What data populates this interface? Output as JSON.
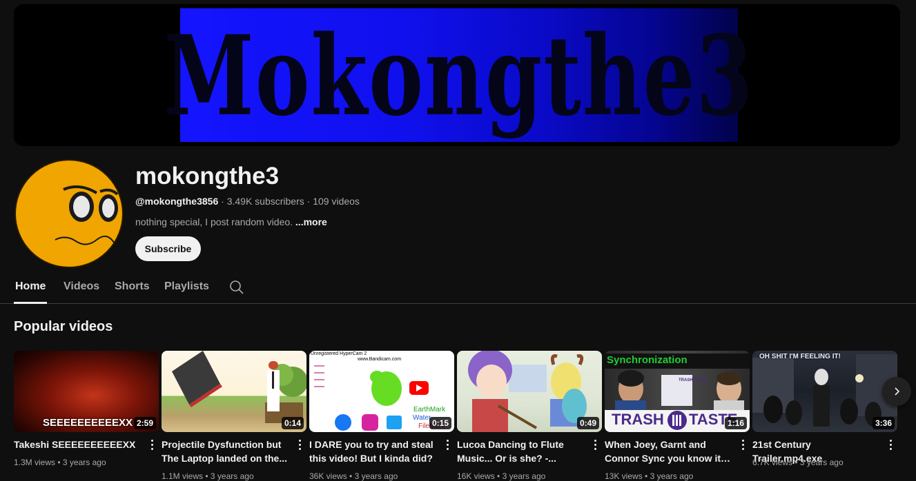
{
  "banner": {
    "text": "Mokongthe3"
  },
  "channel": {
    "name": "mokongthe3",
    "handle": "@mokongthe3856",
    "subscribers": "3.49K subscribers",
    "videos_count": "109 videos",
    "description": "nothing special, I post random video.",
    "more_label": "...more",
    "subscribe_label": "Subscribe"
  },
  "tabs": [
    {
      "label": "Home",
      "active": true
    },
    {
      "label": "Videos",
      "active": false
    },
    {
      "label": "Shorts",
      "active": false
    },
    {
      "label": "Playlists",
      "active": false
    }
  ],
  "section": {
    "title": "Popular videos"
  },
  "videos": [
    {
      "title": "Takeshi SEEEEEEEEEEXX",
      "duration": "2:59",
      "views": "1.3M views",
      "age": "3 years ago",
      "overlay": "SEEEEEEEEEEXX"
    },
    {
      "title": "Projectile Dysfunction but The Laptop landed on the...",
      "duration": "0:14",
      "views": "1.1M views",
      "age": "3 years ago"
    },
    {
      "title": "I DARE you to try and steal this video! But I kinda did?",
      "duration": "0:15",
      "views": "36K views",
      "age": "3 years ago",
      "overlay_top": "Unregistered HyperCam 2",
      "overlay_url": "www.Bandicam.com",
      "overlay_brand": "EarthMark",
      "overlay_water": "Water",
      "overlay_file": "FileMark"
    },
    {
      "title": "Lucoa Dancing to Flute Music... Or is she? -...",
      "duration": "0:49",
      "views": "16K views",
      "age": "3 years ago"
    },
    {
      "title": "When Joey, Garnt and Connor Sync you know it's the...",
      "duration": "1:16",
      "views": "13K views",
      "age": "3 years ago",
      "overlay_top": "Synchronization",
      "overlay_bottom_left": "TRASH",
      "overlay_bottom_right": "TASTE",
      "overlay_sign": "TRASH TASTE"
    },
    {
      "title": "21st Century Trailer.mp4.exe",
      "duration": "3:36",
      "views": "6.7K views",
      "age": "3 years ago",
      "overlay_top": "OH SHIT I'M FEELING IT!"
    }
  ],
  "colors": {
    "background": "#0f0f0f",
    "banner_blue": "#1414ff",
    "avatar_yellow": "#f0a500"
  }
}
